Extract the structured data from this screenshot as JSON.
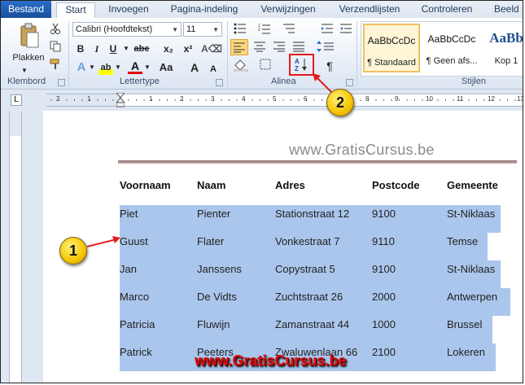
{
  "tabs": [
    {
      "label": "Bestand"
    },
    {
      "label": "Start"
    },
    {
      "label": "Invoegen"
    },
    {
      "label": "Pagina-indeling"
    },
    {
      "label": "Verwijzingen"
    },
    {
      "label": "Verzendlijsten"
    },
    {
      "label": "Controleren"
    },
    {
      "label": "Beeld"
    }
  ],
  "clipboard": {
    "paste_label": "Plakken",
    "group_label": "Klembord"
  },
  "font": {
    "name": "Calibri (Hoofdtekst)",
    "size": "11",
    "group_label": "Lettertype",
    "bold": "B",
    "italic": "I",
    "underline": "U",
    "strike": "abe",
    "subscript": "x₂",
    "superscript": "x²",
    "grow": "A",
    "shrink": "A",
    "change_case": "Aa",
    "highlight": "ab",
    "font_color": "A"
  },
  "paragraph": {
    "group_label": "Alinea",
    "pilcrow": "¶",
    "sort": "A↓"
  },
  "styles": {
    "group_label": "Stijlen",
    "items": [
      {
        "sample": "AaBbCcDc",
        "name": "¶ Standaard"
      },
      {
        "sample": "AaBbCcDc",
        "name": "¶ Geen afs..."
      },
      {
        "sample": "AaBb",
        "name": "Kop 1"
      }
    ]
  },
  "ruler": {
    "marks": [
      "2",
      "1",
      "1",
      "2",
      "3",
      "4",
      "5",
      "6",
      "7",
      "8",
      "9",
      "10",
      "11",
      "12",
      "13"
    ]
  },
  "document": {
    "header_text": "www.GratisCursus.be",
    "table": {
      "headers": [
        "Voornaam",
        "Naam",
        "Adres",
        "Postcode",
        "Gemeente"
      ],
      "rows": [
        [
          "Piet",
          "Pienter",
          "Stationstraat 12",
          "9100",
          "St-Niklaas"
        ],
        [
          "Guust",
          "Flater",
          "Vonkestraat 7",
          "9110",
          "Temse"
        ],
        [
          "Jan",
          "Janssens",
          "Copystraat 5",
          "9100",
          "St-Niklaas"
        ],
        [
          "Marco",
          "De Vidts",
          "Zuchtstraat 26",
          "2000",
          "Antwerpen"
        ],
        [
          "Patricia",
          "Fluwijn",
          "Zamanstraat 44",
          "1000",
          "Brussel"
        ],
        [
          "Patrick",
          "Peeters",
          "Zwaluwenlaan 66",
          "2100",
          "Lokeren"
        ]
      ]
    }
  },
  "callouts": {
    "one": "1",
    "two": "2"
  },
  "watermark": "www.GratisCursus.be",
  "colors": {
    "selection": "#aac6ec",
    "callout": "#f5c400",
    "highlight_box": "#e31c1c",
    "watermark": "#e20e0e"
  }
}
